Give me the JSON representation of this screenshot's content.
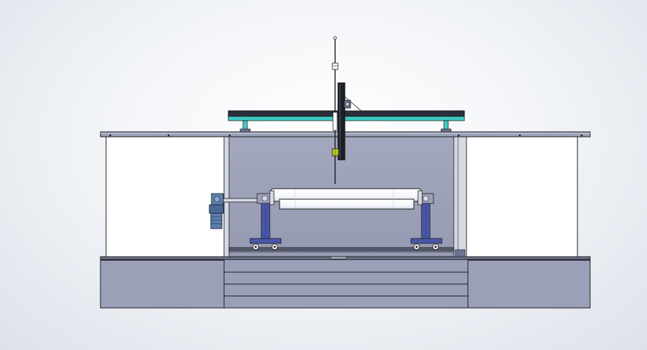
{
  "colors": {
    "background": "#eef1f5",
    "steel": "#9aa0b8",
    "steel_dark": "#6e7490",
    "outline": "#1a1a1a",
    "rail_teal": "#3fd0c8",
    "stand_blue": "#4a56a8",
    "motor_blue": "#5a7fb0",
    "pipe_white": "#ffffff",
    "sensor_yellow": "#b8c820",
    "glass": "#ffffff"
  },
  "icons": {
    "gearmotor": "gearmotor-icon",
    "caster_wheel": "caster-wheel-icon"
  }
}
